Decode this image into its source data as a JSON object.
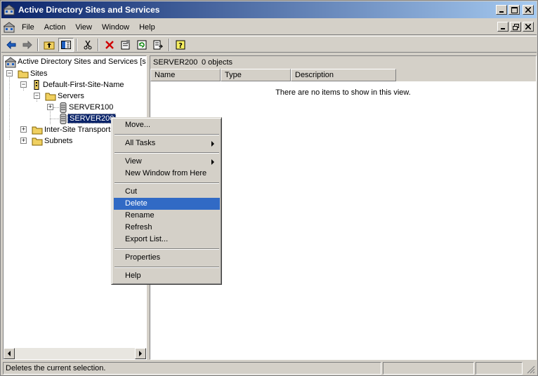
{
  "window": {
    "title": "Active Directory Sites and Services"
  },
  "menubar": {
    "items": [
      {
        "label": "File"
      },
      {
        "label": "Action"
      },
      {
        "label": "View"
      },
      {
        "label": "Window"
      },
      {
        "label": "Help"
      }
    ]
  },
  "tree": {
    "root_label": "Active Directory Sites and Services [se",
    "nodes": [
      {
        "label": "Sites"
      },
      {
        "label": "Default-First-Site-Name"
      },
      {
        "label": "Servers"
      },
      {
        "label": "SERVER100"
      },
      {
        "label": "SERVER200"
      },
      {
        "label": "Inter-Site Transports"
      },
      {
        "label": "Subnets"
      }
    ]
  },
  "details": {
    "header_title": "SERVER200",
    "header_count": "0 objects",
    "columns": [
      "Name",
      "Type",
      "Description"
    ],
    "empty_message": "There are no items to show in this view."
  },
  "context_menu": {
    "items": [
      {
        "label": "Move..."
      },
      {
        "label": "All Tasks"
      },
      {
        "label": "View"
      },
      {
        "label": "New Window from Here"
      },
      {
        "label": "Cut"
      },
      {
        "label": "Delete"
      },
      {
        "label": "Rename"
      },
      {
        "label": "Refresh"
      },
      {
        "label": "Export List..."
      },
      {
        "label": "Properties"
      },
      {
        "label": "Help"
      }
    ],
    "highlighted": "Delete"
  },
  "statusbar": {
    "message": "Deletes the current selection."
  },
  "colors": {
    "title_active": "#0a246a",
    "title_gradient_end": "#a6caf0",
    "selection": "#0a246a",
    "menu_highlight": "#316ac5",
    "chrome": "#d4d0c8"
  }
}
